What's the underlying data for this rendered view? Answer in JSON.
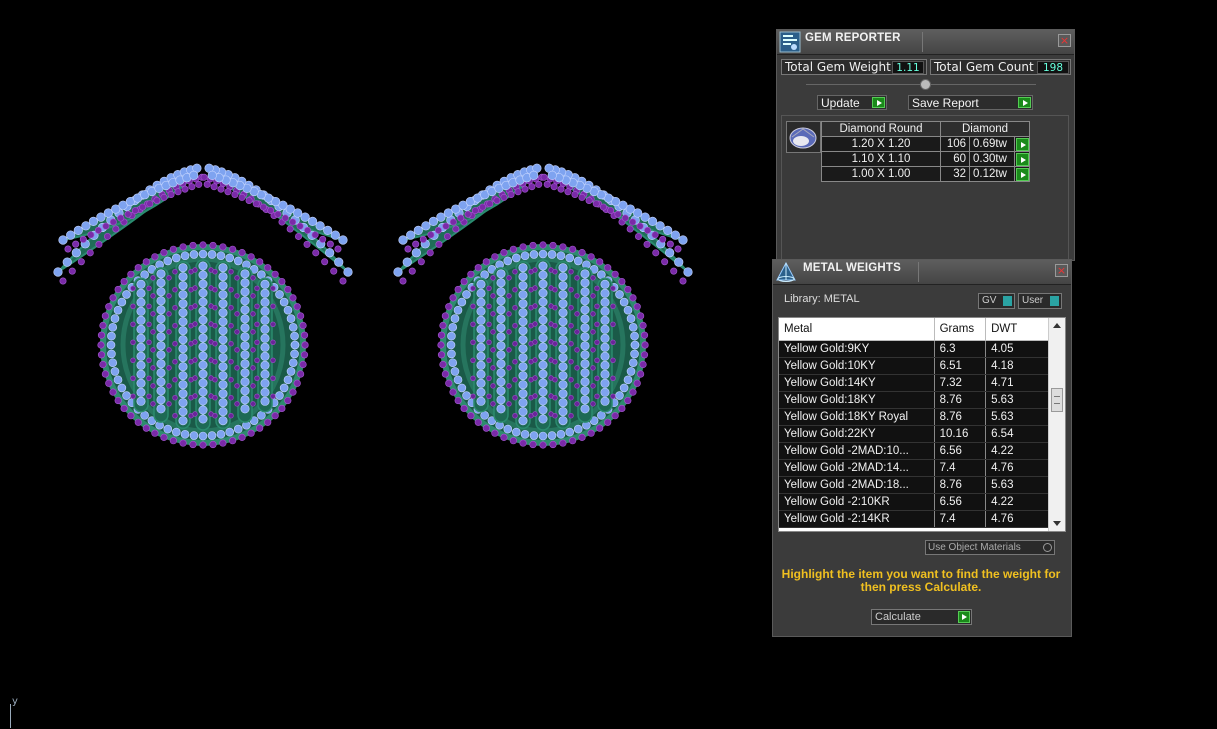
{
  "viewport": {
    "axis_label": "y"
  },
  "gem_reporter": {
    "title": "GEM REPORTER",
    "close": "×",
    "total_gem_weight_label": "Total Gem Weight",
    "total_gem_weight": "1.11",
    "total_gem_count_label": "Total Gem Count",
    "total_gem_count": "198",
    "update_label": "Update",
    "save_report_label": "Save Report",
    "table": {
      "headers": [
        "Diamond Round",
        "Diamond"
      ],
      "rows": [
        {
          "size": "1.20 X 1.20",
          "count": "106",
          "weight": "0.69tw"
        },
        {
          "size": "1.10 X 1.10",
          "count": "60",
          "weight": "0.30tw"
        },
        {
          "size": "1.00 X 1.00",
          "count": "32",
          "weight": "0.12tw"
        }
      ]
    }
  },
  "metal_weights": {
    "title": "METAL WEIGHTS",
    "close": "×",
    "library_label": "Library: METAL",
    "gv_label": "GV",
    "user_label": "User",
    "columns": [
      "Metal",
      "Grams",
      "DWT"
    ],
    "rows": [
      {
        "metal": "Yellow Gold:9KY",
        "grams": "6.3",
        "dwt": "4.05"
      },
      {
        "metal": "Yellow Gold:10KY",
        "grams": "6.51",
        "dwt": "4.18"
      },
      {
        "metal": "Yellow Gold:14KY",
        "grams": "7.32",
        "dwt": "4.71"
      },
      {
        "metal": "Yellow Gold:18KY",
        "grams": "8.76",
        "dwt": "5.63"
      },
      {
        "metal": "Yellow Gold:18KY Royal",
        "grams": "8.76",
        "dwt": "5.63"
      },
      {
        "metal": "Yellow Gold:22KY",
        "grams": "10.16",
        "dwt": "6.54"
      },
      {
        "metal": "Yellow Gold -2MAD:10...",
        "grams": "6.56",
        "dwt": "4.22"
      },
      {
        "metal": "Yellow Gold -2MAD:14...",
        "grams": "7.4",
        "dwt": "4.76"
      },
      {
        "metal": "Yellow Gold -2MAD:18...",
        "grams": "8.76",
        "dwt": "5.63"
      },
      {
        "metal": "Yellow Gold -2:10KR",
        "grams": "6.56",
        "dwt": "4.22"
      },
      {
        "metal": "Yellow Gold -2:14KR",
        "grams": "7.4",
        "dwt": "4.76"
      }
    ],
    "use_object_materials_label": "Use Object Materials",
    "hint": "Highlight the item you want to find the weight for then press Calculate.",
    "calculate_label": "Calculate"
  }
}
